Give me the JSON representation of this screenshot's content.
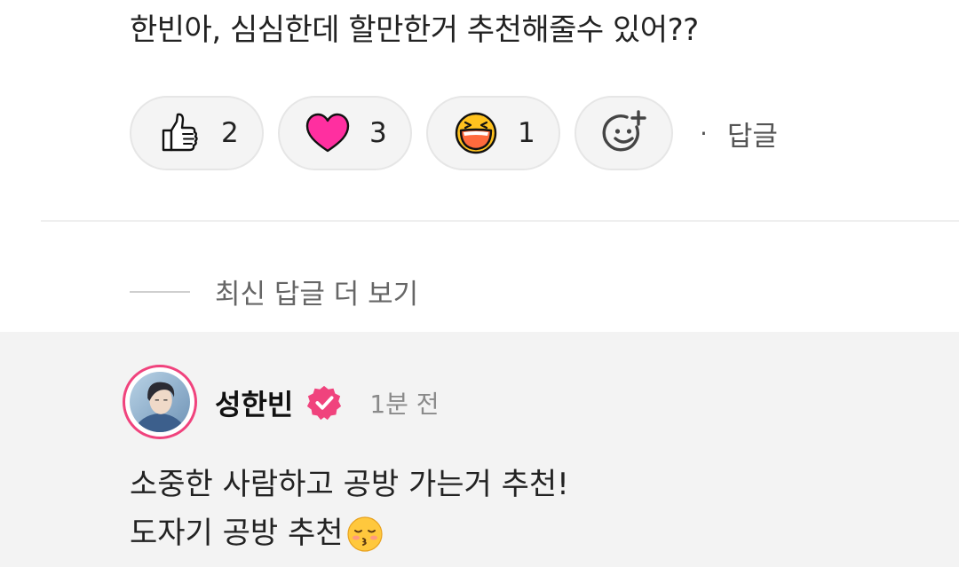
{
  "comment": {
    "text": "한빈아, 심심한데 할만한거 추천해줄수 있어??"
  },
  "reactions": [
    {
      "icon": "thumbs-up-icon",
      "count": "2"
    },
    {
      "icon": "heart-icon",
      "count": "3"
    },
    {
      "icon": "laughing-face-icon",
      "count": "1"
    }
  ],
  "add_reaction_icon": "add-reaction-icon",
  "separator": "·",
  "reply_label": "답글",
  "more_replies_label": "최신 답글 더 보기",
  "reply": {
    "author": "성한빈",
    "time": "1분 전",
    "lines": [
      "소중한 사람하고 공방 가는거 추천!",
      "도자기 공방 추천"
    ],
    "trailing_emoji": "kissing-face-icon"
  },
  "colors": {
    "accent": "#f0437d",
    "heart": "#ff2fa0",
    "laugh": "#ff6a3d",
    "background_reply": "#f3f3f3"
  }
}
